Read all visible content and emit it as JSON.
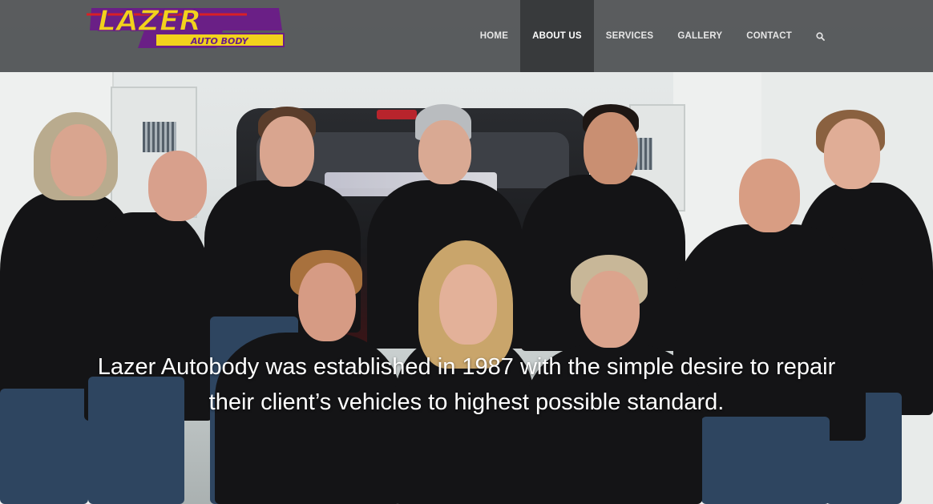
{
  "logo": {
    "text": "LAZER",
    "subtext": "AUTO BODY",
    "colors": {
      "fill": "#f2d21c",
      "stroke": "#6a1f86",
      "accent": "#d91f26"
    }
  },
  "nav": {
    "items": [
      {
        "label": "HOME",
        "active": false
      },
      {
        "label": "ABOUT US",
        "active": true
      },
      {
        "label": "SERVICES",
        "active": false
      },
      {
        "label": "GALLERY",
        "active": false
      },
      {
        "label": "CONTACT",
        "active": false
      }
    ],
    "search_icon": "search-icon"
  },
  "hero": {
    "image": "team-photo",
    "tagline_line1": "Lazer Autobody was established in 1987 with the simple desire to repair",
    "tagline_line2": "their client’s vehicles to highest possible standard."
  },
  "colors": {
    "header_bg": "#46484a",
    "active_nav_bg": "#1e1f21",
    "nav_text": "#e6e6e6"
  }
}
